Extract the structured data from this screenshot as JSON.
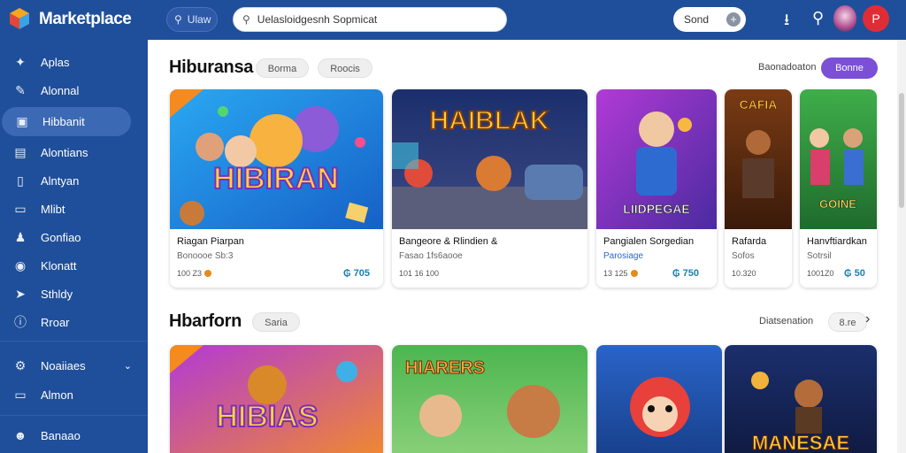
{
  "topbar": {
    "brand": "Marketplace",
    "left_pill": "Ulaw",
    "search_placeholder": "Uelasloidgesnh Sopmicat",
    "right_button": "Sond"
  },
  "sidebar": {
    "items": [
      {
        "label": "Aplas",
        "icon": "apps-icon"
      },
      {
        "label": "Alonnal",
        "icon": "pen-icon"
      },
      {
        "label": "Hibbanit",
        "icon": "briefcase-icon"
      },
      {
        "label": "Alontians",
        "icon": "document-icon"
      },
      {
        "label": "Alntyan",
        "icon": "file-icon"
      },
      {
        "label": "Mlibt",
        "icon": "display-icon"
      },
      {
        "label": "Gonfiao",
        "icon": "person-icon"
      },
      {
        "label": "Klonatt",
        "icon": "globe-icon"
      },
      {
        "label": "Sthldy",
        "icon": "send-icon"
      },
      {
        "label": "Rroar",
        "icon": "info-icon"
      }
    ],
    "lower_items": [
      {
        "label": "Noaiiaes",
        "icon": "gear-icon"
      },
      {
        "label": "Almon",
        "icon": "monitor-icon"
      }
    ],
    "bottom_item": {
      "label": "Banaao",
      "icon": "user-circle-icon"
    }
  },
  "section1": {
    "title": "Hiburansa",
    "chips": [
      "Borma",
      "Roocis"
    ],
    "link": "Baonadoaton",
    "button": "Bonne",
    "cards": [
      {
        "title": "Riagan Piarpan",
        "sub": "Bonoooe Sb:3",
        "meta": "100 Z3",
        "price": "₲ 705",
        "art": "HIBIRAN"
      },
      {
        "title": "Bangeore & Rlindien &",
        "sub": "Fasao 1fs6aooe",
        "meta": "101 16  100",
        "price": "",
        "art": "HAIBLAK"
      },
      {
        "title": "Pangialen Sorgedian",
        "sub": "Parosiage",
        "meta": "13 125",
        "price": "₲ 750",
        "art": "LIIDPEGAE"
      },
      {
        "title": "Rafarda",
        "sub": "Sofos",
        "meta": "10.320",
        "price": "",
        "art": "CAFIA"
      },
      {
        "title": "Hanvftiardkan",
        "sub": "Sotrsil",
        "meta": "1001Z0",
        "price": "₲ 50",
        "art": "GOINE"
      }
    ]
  },
  "section2": {
    "title": "Hbarforn",
    "chip": "Saria",
    "link": "Diatsenation",
    "more": "8.re",
    "cards": [
      {
        "art": "HIBIAS"
      },
      {
        "art": "HIARERS"
      },
      {
        "art": ""
      },
      {
        "art": "MANESAE"
      }
    ]
  },
  "colors": {
    "sidebar": "#1f4f9a",
    "accent_purple": "#7b4fd6",
    "avatar_red": "#e02d35",
    "price_blue": "#1c7fae"
  }
}
